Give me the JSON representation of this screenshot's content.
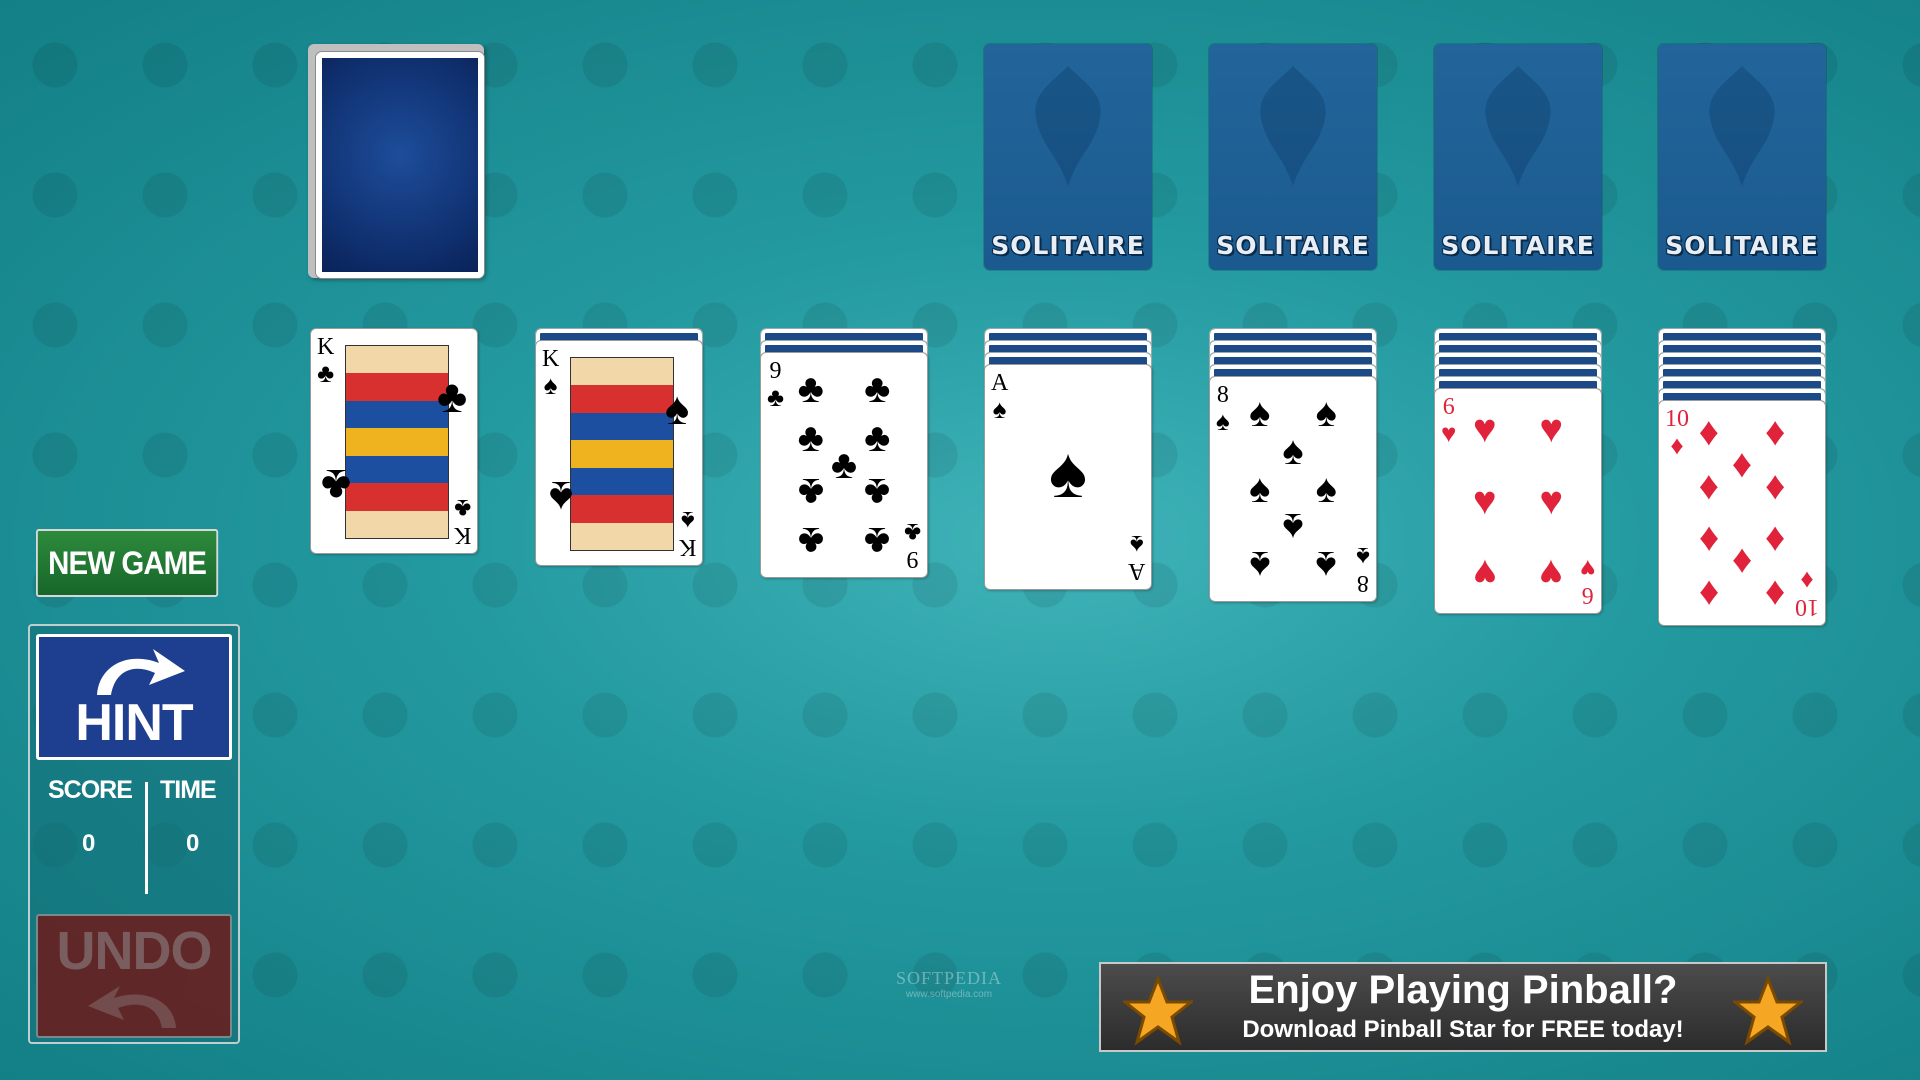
{
  "buttons": {
    "new_game": "NEW GAME",
    "hint": "HINT",
    "undo": "UNDO"
  },
  "stats": {
    "score_label": "SCORE",
    "time_label": "TIME",
    "score": "0",
    "time": "0"
  },
  "foundations": [
    {
      "label": "SOLITAIRE"
    },
    {
      "label": "SOLITAIRE"
    },
    {
      "label": "SOLITAIRE"
    },
    {
      "label": "SOLITAIRE"
    }
  ],
  "tableau": [
    {
      "hidden": 0,
      "rank": "K",
      "suit": "♣",
      "color": "black"
    },
    {
      "hidden": 1,
      "rank": "K",
      "suit": "♠",
      "color": "black"
    },
    {
      "hidden": 2,
      "rank": "9",
      "suit": "♣",
      "color": "black"
    },
    {
      "hidden": 3,
      "rank": "A",
      "suit": "♠",
      "color": "black"
    },
    {
      "hidden": 4,
      "rank": "8",
      "suit": "♠",
      "color": "black"
    },
    {
      "hidden": 5,
      "rank": "6",
      "suit": "♥",
      "color": "red"
    },
    {
      "hidden": 6,
      "rank": "10",
      "suit": "♦",
      "color": "red"
    }
  ],
  "ad": {
    "headline": "Enjoy Playing Pinball?",
    "subline": "Download Pinball Star for FREE today!"
  },
  "watermark": {
    "brand": "SOFTPEDIA",
    "url": "www.softpedia.com"
  },
  "colors": {
    "table": "#239aa0",
    "card_back": "#0f2f6e",
    "new_game": "#1f7a31",
    "hint": "#1e3e8f",
    "undo": "#6e1a1a",
    "red_suit": "#e0233b"
  }
}
